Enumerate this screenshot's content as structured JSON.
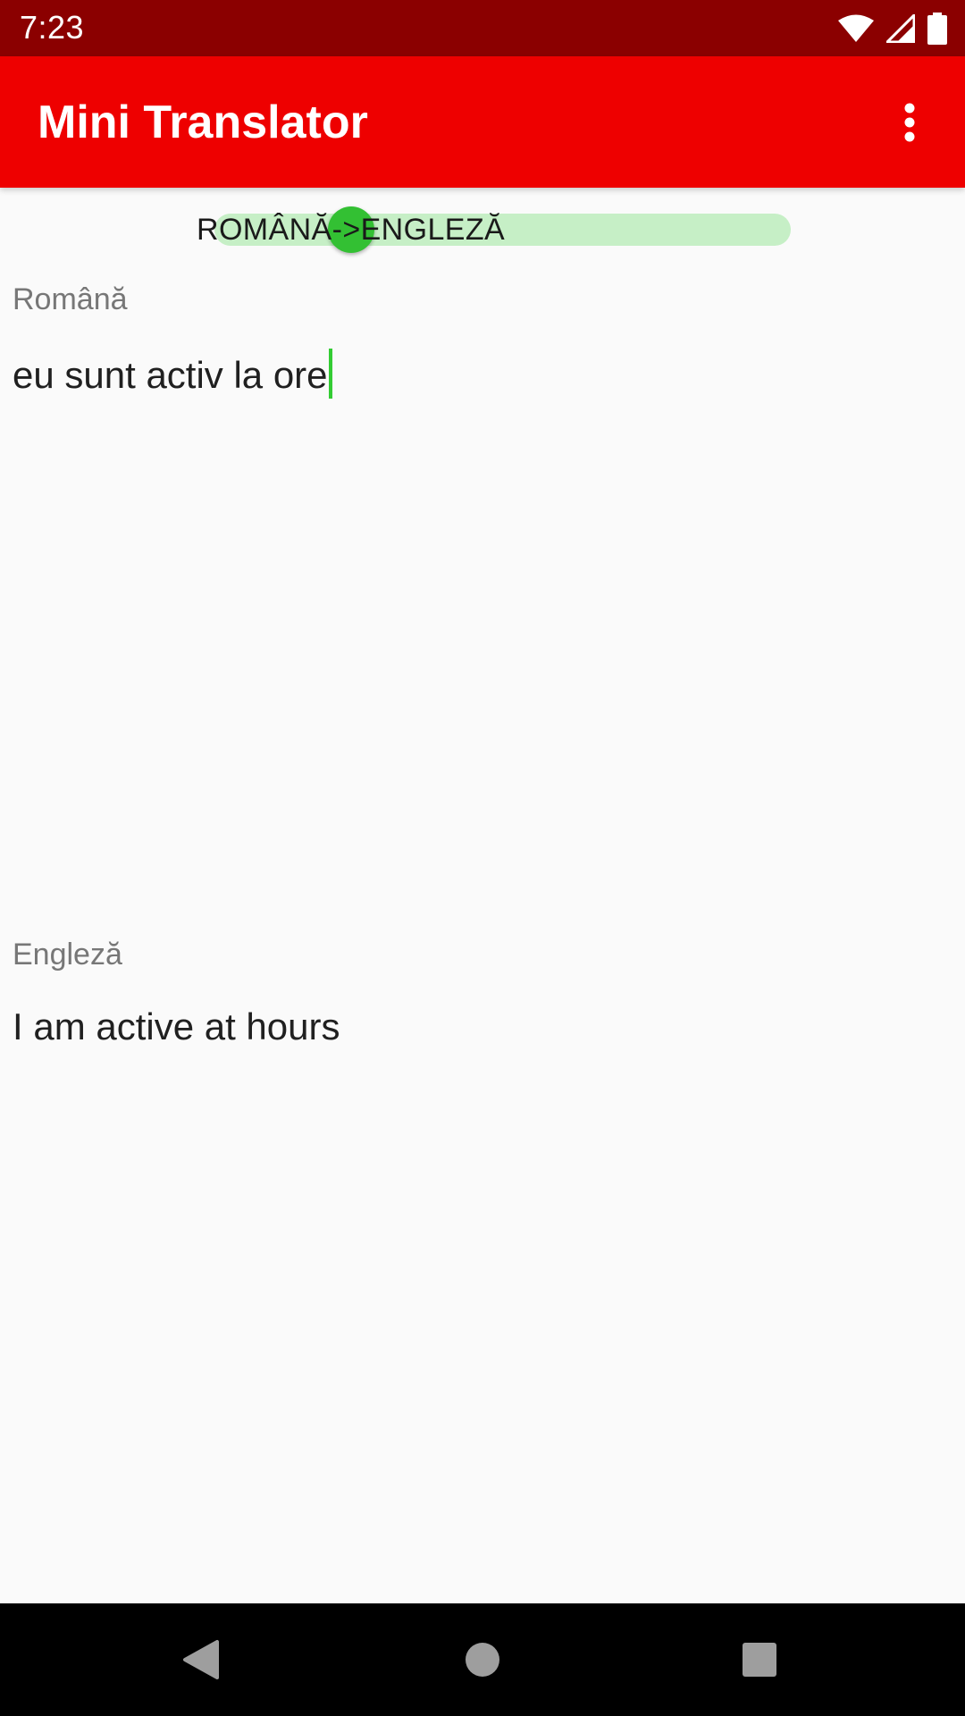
{
  "status_bar": {
    "time": "7:23",
    "icons": [
      "wifi-icon",
      "signal-icon",
      "battery-icon"
    ]
  },
  "app_bar": {
    "title": "Mini Translator",
    "menu_icon": "more-vert-icon"
  },
  "direction_switch": {
    "label": "ROMÂNĂ->ENGLEZĂ",
    "checked": false,
    "track_color": "#c6efc6",
    "thumb_color": "#33c033"
  },
  "source": {
    "label": "Română",
    "value": "eu sunt activ la ore"
  },
  "target": {
    "label": "Engleză",
    "value": "I am active at hours"
  },
  "nav_bar": {
    "icons": [
      "back-icon",
      "home-icon",
      "recents-icon"
    ]
  },
  "colors": {
    "status_bar": "#8b0000",
    "app_bar": "#ee0000",
    "accent": "#33cc33",
    "background": "#fafafa"
  }
}
